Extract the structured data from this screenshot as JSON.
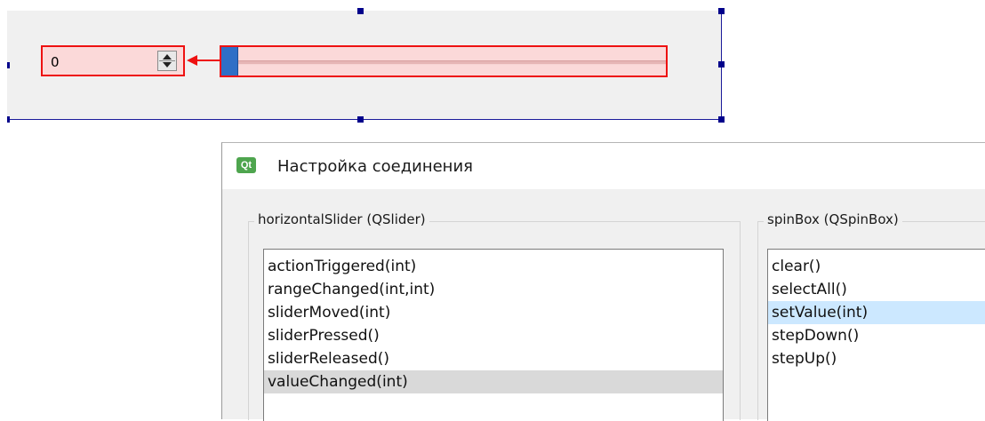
{
  "spinbox": {
    "value": "0"
  },
  "slider": {
    "value_fraction": 0.0
  },
  "dialog": {
    "title": "Настройка соединения",
    "icon_label": "Qt",
    "sender": {
      "label": "horizontalSlider (QSlider)",
      "signals": [
        "actionTriggered(int)",
        "rangeChanged(int,int)",
        "sliderMoved(int)",
        "sliderPressed()",
        "sliderReleased()",
        "valueChanged(int)"
      ],
      "selected_index": 5
    },
    "receiver": {
      "label": "spinBox (QSpinBox)",
      "slots": [
        "clear()",
        "selectAll()",
        "setValue(int)",
        "stepDown()",
        "stepUp()"
      ],
      "selected_index": 2
    }
  },
  "colors": {
    "connection_red": "#ee1111",
    "selection_blue": "#cce8ff",
    "handle_blue": "#2f6fc6"
  }
}
